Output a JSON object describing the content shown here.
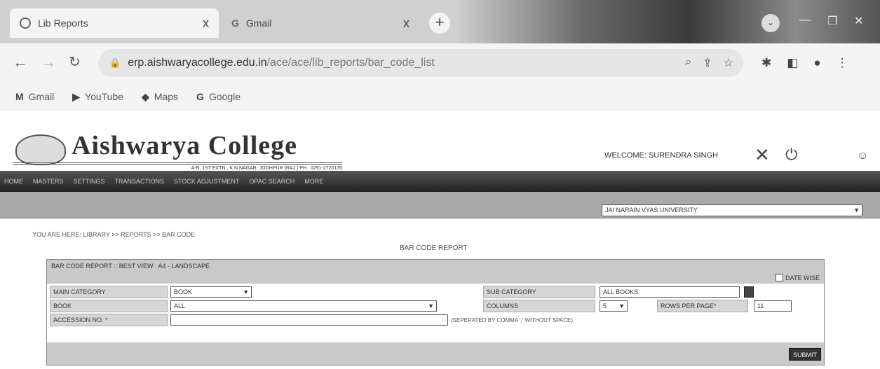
{
  "browser": {
    "tabs": [
      {
        "title": "Lib Reports",
        "close": "x"
      },
      {
        "title": "Gmail",
        "close": "x"
      }
    ],
    "new_tab": "+",
    "url": {
      "host": "erp.aishwaryacollege.edu.in",
      "path": "/ace/ace/lib_reports/bar_code_list"
    },
    "bookmarks": [
      {
        "icon": "M",
        "label": "Gmail"
      },
      {
        "icon": "▶",
        "label": "YouTube"
      },
      {
        "icon": "◆",
        "label": "Maps"
      },
      {
        "icon": "G",
        "label": "Google"
      }
    ]
  },
  "header": {
    "college_name": "Aishwarya College",
    "college_subtitle": "A-B, 1ST EXTN., K N NAGAR, JODHPUR (RAJ.) PH.: 0291-2720135",
    "welcome": "WELCOME: SURENDRA SINGH"
  },
  "menu": [
    "HOME",
    "MASTERS",
    "SETTINGS",
    "TRANSACTIONS",
    "STOCK ADJUSTMENT",
    "OPAC SEARCH",
    "MORE"
  ],
  "university_select": {
    "value": "JAI NARAIN VYAS UNIVERSITY"
  },
  "breadcrumb": "YOU ARE HERE:  LIBRARY >> REPORTS >> BAR CODE",
  "report": {
    "title": "BAR CODE REPORT",
    "box_header": "BAR CODE REPORT :: BEST VIEW : A4 - LANDSCAPE",
    "date_wise_label": "DATE WISE",
    "fields": {
      "main_category": {
        "label": "MAIN CATEGORY",
        "value": "BOOK"
      },
      "sub_category": {
        "label": "SUB CATEGORY",
        "value": "ALL BOOKS"
      },
      "book": {
        "label": "BOOK",
        "value": "ALL"
      },
      "columns": {
        "label": "COLUMNS",
        "value": "5"
      },
      "rows_per_page": {
        "label": "ROWS PER PAGE*",
        "value": "11"
      },
      "accession_no": {
        "label": "ACCESSION NO. *",
        "value": "",
        "note": "(SEPERATED BY COMMA ',' WITHOUT SPACE)"
      }
    },
    "submit_label": "SUBMIT"
  }
}
